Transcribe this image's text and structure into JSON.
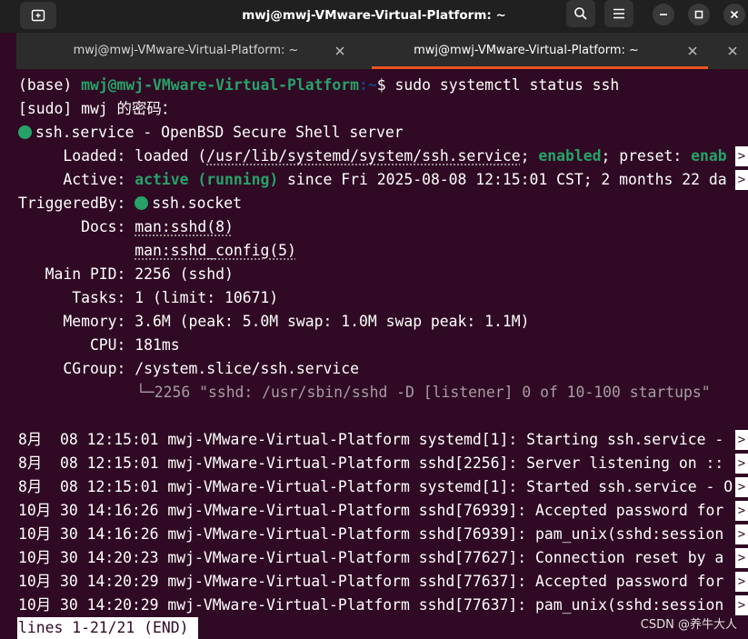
{
  "window": {
    "title": "mwj@mwj-VMware-Virtual-Platform: ~"
  },
  "tabs": [
    {
      "label": "mwj@mwj-VMware-Virtual-Platform: ~",
      "active": false
    },
    {
      "label": "mwj@mwj-VMware-Virtual-Platform: ~",
      "active": true
    }
  ],
  "terminal": {
    "prompt": {
      "env": "(base) ",
      "user_host": "mwj@mwj-VMware-Virtual-Platform",
      "path": ":~",
      "symbol": "$ ",
      "command": "sudo systemctl status ssh"
    },
    "sudo_prompt": "[sudo] mwj 的密码：",
    "service_line": "ssh.service - OpenBSD Secure Shell server",
    "loaded": {
      "label": "     Loaded: ",
      "pre": "loaded (",
      "path": "/usr/lib/systemd/system/ssh.service",
      "sep": "; ",
      "enabled": "enabled",
      "rest": "; preset: ",
      "preset": "enab"
    },
    "active": {
      "label": "     Active: ",
      "state": "active (running)",
      "rest": " since Fri 2025-08-08 12:15:01 CST; 2 months 22 da"
    },
    "triggered": {
      "label": "TriggeredBy: ",
      "value": "ssh.socket"
    },
    "docs": {
      "label": "       Docs: ",
      "value1": "man:sshd(8)",
      "indent": "             ",
      "value2": "man:sshd_config(5)"
    },
    "main_pid": "   Main PID: 2256 (sshd)",
    "tasks": "      Tasks: 1 (limit: 10671)",
    "memory": "     Memory: 3.6M (peak: 5.0M swap: 1.0M swap peak: 1.1M)",
    "cpu": "        CPU: 181ms",
    "cgroup": {
      "label": "     CGroup: ",
      "value": "/system.slice/ssh.service"
    },
    "cgroup_child": "2256 \"sshd: /usr/sbin/sshd -D [listener] 0 of 10-100 startups\"",
    "log_lines": [
      "8月  08 12:15:01 mwj-VMware-Virtual-Platform systemd[1]: Starting ssh.service - ",
      "8月  08 12:15:01 mwj-VMware-Virtual-Platform sshd[2256]: Server listening on :: ",
      "8月  08 12:15:01 mwj-VMware-Virtual-Platform systemd[1]: Started ssh.service - O",
      "10月 30 14:16:26 mwj-VMware-Virtual-Platform sshd[76939]: Accepted password for",
      "10月 30 14:16:26 mwj-VMware-Virtual-Platform sshd[76939]: pam_unix(sshd:session",
      "10月 30 14:20:23 mwj-VMware-Virtual-Platform sshd[77627]: Connection reset by a",
      "10月 30 14:20:29 mwj-VMware-Virtual-Platform sshd[77637]: Accepted password for",
      "10月 30 14:20:29 mwj-VMware-Virtual-Platform sshd[77637]: pam_unix(sshd:session"
    ],
    "overflow_marker": ">",
    "pager_status": "lines 1-21/21 (END)"
  },
  "watermark": "CSDN @养牛大人",
  "colors": {
    "background": "#300a24",
    "green": "#26a269",
    "blue": "#12488b",
    "accent": "#e95420"
  },
  "icons": [
    "new-tab-icon",
    "search-icon",
    "menu-icon",
    "minimize-icon",
    "maximize-icon",
    "close-icon",
    "tab-close-icon",
    "status-dot-icon"
  ]
}
